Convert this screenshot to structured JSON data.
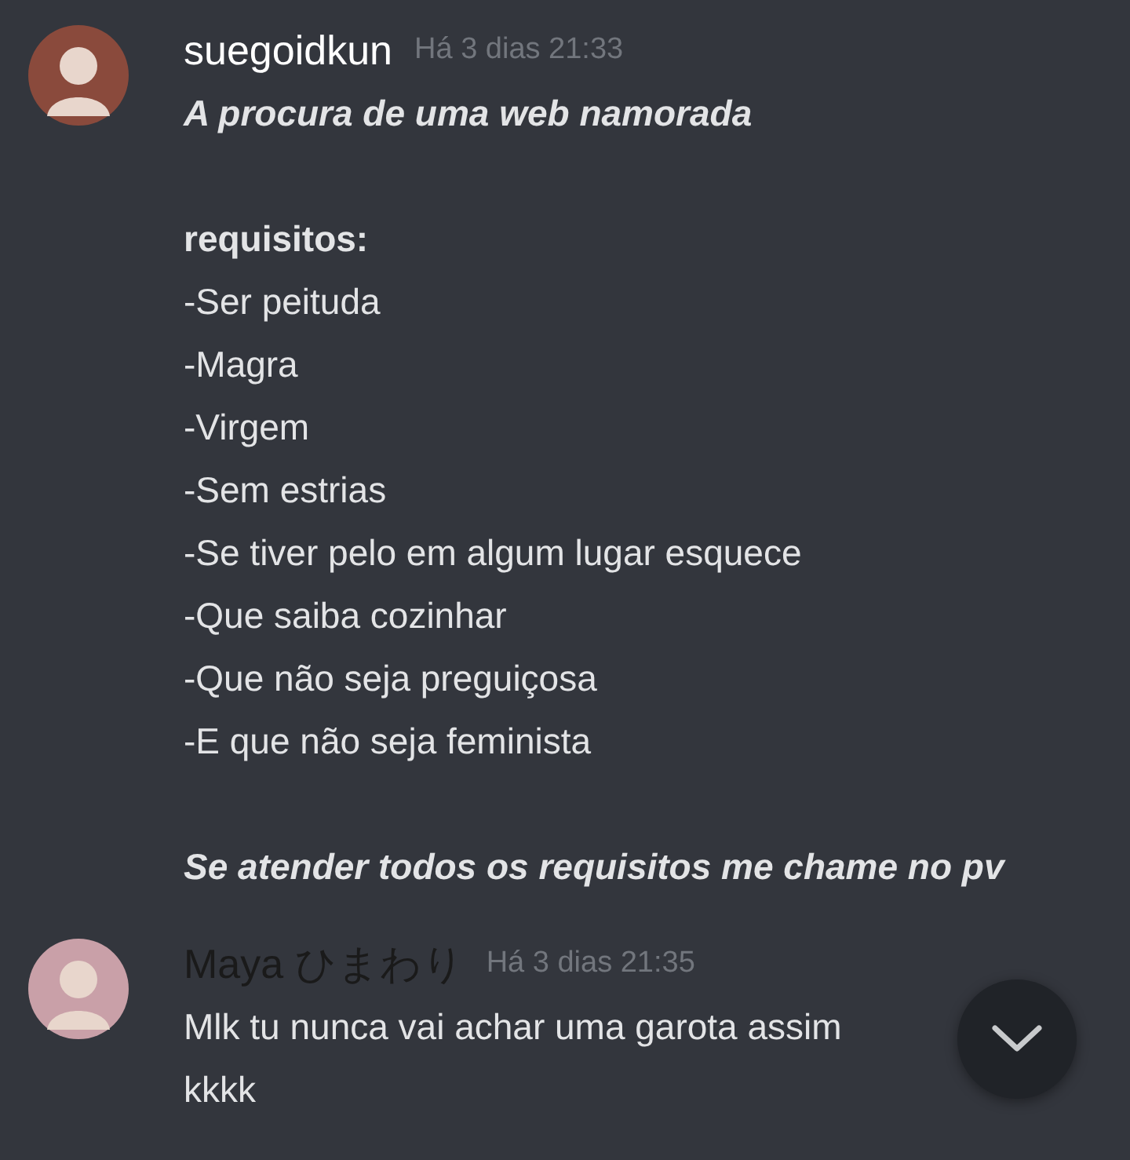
{
  "messages": [
    {
      "author": "suegoidkun",
      "color": "#ffffff",
      "time": "Há 3 dias 21:33",
      "paragraphs": [
        {
          "lines": [
            {
              "text": "A procura de uma web namorada",
              "kind": "italic"
            }
          ]
        },
        {
          "lines": [
            {
              "text": "requisitos:",
              "kind": "bold"
            },
            {
              "text": "-Ser peituda",
              "kind": "plain"
            },
            {
              "text": "-Magra",
              "kind": "plain"
            },
            {
              "text": "-Virgem",
              "kind": "plain"
            },
            {
              "text": "-Sem estrias",
              "kind": "plain"
            },
            {
              "text": "-Se tiver pelo em algum lugar esquece",
              "kind": "plain"
            },
            {
              "text": "-Que saiba cozinhar",
              "kind": "plain"
            },
            {
              "text": "-Que não seja preguiçosa",
              "kind": "plain"
            },
            {
              "text": "-E que não seja feminista",
              "kind": "plain"
            }
          ]
        },
        {
          "lines": [
            {
              "text": "Se atender todos os requisitos me chame no pv",
              "kind": "italic"
            }
          ]
        }
      ]
    },
    {
      "author": "Maya ひまわり",
      "color": "#1a1a1a",
      "time": "Há 3 dias 21:35",
      "paragraphs": [
        {
          "lines": [
            {
              "text": "Mlk tu nunca vai achar uma garota assim",
              "kind": "plain"
            },
            {
              "text": "kkkk",
              "kind": "plain"
            }
          ]
        }
      ]
    }
  ]
}
